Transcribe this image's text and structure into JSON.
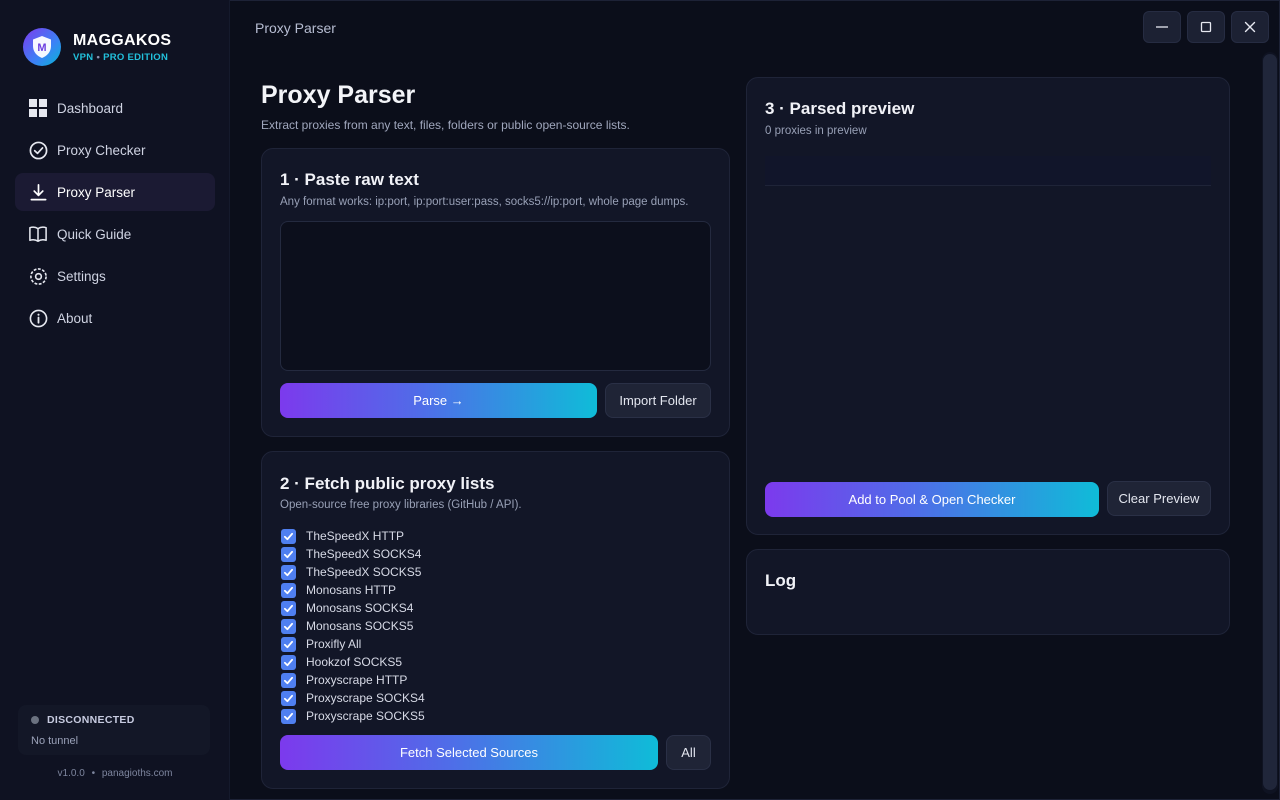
{
  "brand": {
    "name": "MAGGAKOS",
    "logo_letter": "M",
    "sub_left": "VPN",
    "sub_sep": "•",
    "sub_right": "PRO EDITION"
  },
  "window": {
    "title": "Proxy Parser"
  },
  "nav": [
    {
      "label": "Dashboard",
      "icon": "grid-icon",
      "active": false
    },
    {
      "label": "Proxy Checker",
      "icon": "check-circle-icon",
      "active": false
    },
    {
      "label": "Proxy Parser",
      "icon": "download-icon",
      "active": true
    },
    {
      "label": "Quick Guide",
      "icon": "book-icon",
      "active": false
    },
    {
      "label": "Settings",
      "icon": "gear-icon",
      "active": false
    },
    {
      "label": "About",
      "icon": "info-icon",
      "active": false
    }
  ],
  "status": {
    "state": "DISCONNECTED",
    "detail": "No tunnel",
    "dot_color": "#6b7280"
  },
  "footer": {
    "version": "v1.0.0",
    "sep": "•",
    "site": "panagioths.com"
  },
  "page": {
    "title": "Proxy Parser",
    "subtitle": "Extract proxies from any text, files, folders or public open-source lists."
  },
  "paste": {
    "title": "1 · Paste raw text",
    "subtitle": "Any format works: ip:port, ip:port:user:pass, socks5://ip:port, whole page dumps.",
    "value": "",
    "parse_label": "Parse →",
    "import_label": "Import Folder"
  },
  "fetch": {
    "title": "2 · Fetch public proxy lists",
    "subtitle": "Open-source free proxy libraries (GitHub / API).",
    "sources": [
      {
        "label": "TheSpeedX HTTP",
        "checked": true
      },
      {
        "label": "TheSpeedX SOCKS4",
        "checked": true
      },
      {
        "label": "TheSpeedX SOCKS5",
        "checked": true
      },
      {
        "label": "Monosans HTTP",
        "checked": true
      },
      {
        "label": "Monosans SOCKS4",
        "checked": true
      },
      {
        "label": "Monosans SOCKS5",
        "checked": true
      },
      {
        "label": "Proxifly All",
        "checked": true
      },
      {
        "label": "Hookzof SOCKS5",
        "checked": true
      },
      {
        "label": "Proxyscrape HTTP",
        "checked": true
      },
      {
        "label": "Proxyscrape SOCKS4",
        "checked": true
      },
      {
        "label": "Proxyscrape SOCKS5",
        "checked": true
      }
    ],
    "fetch_label": "Fetch Selected Sources",
    "all_label": "All"
  },
  "preview": {
    "title": "3 · Parsed preview",
    "count_text": "0 proxies in preview",
    "add_label": "Add to Pool & Open Checker",
    "clear_label": "Clear Preview"
  },
  "log": {
    "title": "Log"
  },
  "colors": {
    "accent_purple": "#7c3aed",
    "accent_cyan": "#0fbcd8",
    "checkbox": "#4f7ff0",
    "brand_sub": "#22c1dc"
  }
}
